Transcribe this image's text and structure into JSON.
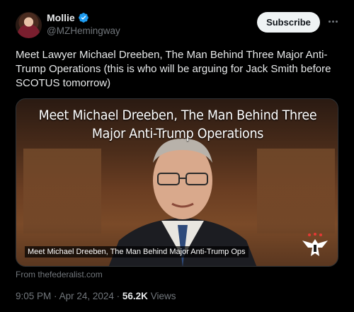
{
  "author": {
    "display_name": "Mollie",
    "handle": "@MZHemingway"
  },
  "actions": {
    "subscribe_label": "Subscribe"
  },
  "tweet": {
    "text": "Meet Lawyer Michael Dreeben, The Man Behind Three Major Anti-Trump Operations (this is who will be arguing for Jack Smith before SCOTUS tomorrow)"
  },
  "media": {
    "headline_line1": "Meet Michael Dreeben, The Man Behind Three",
    "headline_line2": "Major Anti-Trump Operations",
    "caption": "Meet Michael Dreeben, The Man Behind Major Anti-Trump Ops",
    "source": "From thefederalist.com"
  },
  "meta": {
    "time": "9:05 PM",
    "separator": "·",
    "date": "Apr 24, 2024",
    "views_count": "56.2K",
    "views_label": "Views"
  },
  "colors": {
    "background": "#000000",
    "text_primary": "#e7e9ea",
    "text_secondary": "#71767b",
    "verified_blue": "#1d9bf0",
    "subscribe_bg": "#eff3f4"
  }
}
